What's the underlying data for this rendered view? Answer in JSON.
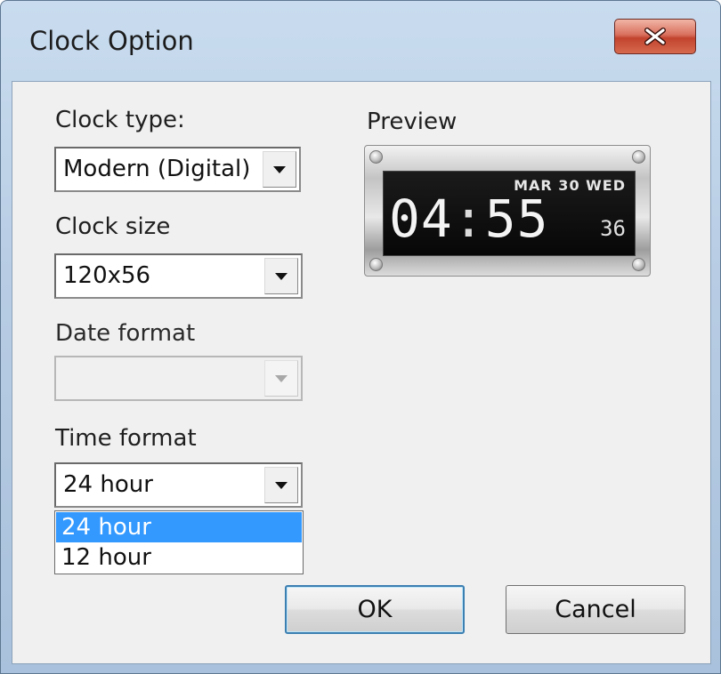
{
  "window": {
    "title": "Clock Option"
  },
  "clock_type": {
    "label": "Clock type:",
    "value": "Modern (Digital)"
  },
  "clock_size": {
    "label": "Clock size",
    "value": "120x56"
  },
  "date_format": {
    "label": "Date format",
    "value": ""
  },
  "time_format": {
    "label": "Time format",
    "value": "24 hour",
    "options": [
      "24 hour",
      "12 hour"
    ],
    "selected_option": "24 hour"
  },
  "preview": {
    "label": "Preview",
    "date": "MAR 30 WED",
    "hours": "04",
    "colon": ":",
    "minutes": "55",
    "seconds": "36"
  },
  "buttons": {
    "ok": "OK",
    "cancel": "Cancel"
  },
  "icons": {
    "close": "close-icon",
    "dropdown": "chevron-down-icon"
  },
  "colors": {
    "selection": "#3399ff",
    "close_button": "#c2432e"
  }
}
